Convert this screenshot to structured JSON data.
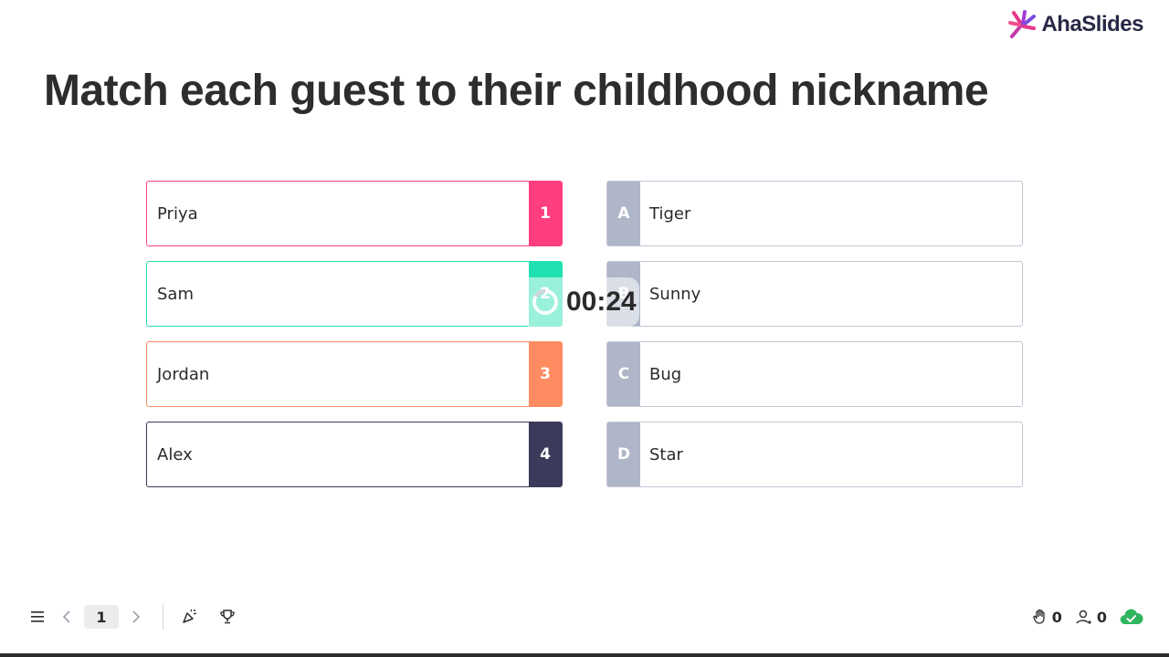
{
  "brand": {
    "name": "AhaSlides"
  },
  "slide": {
    "title": "Match each guest to their childhood nickname"
  },
  "left_items": [
    {
      "text": "Priya",
      "badge": "1",
      "color": "#ff3e80"
    },
    {
      "text": "Sam",
      "badge": "2",
      "color": "#1fe0b0"
    },
    {
      "text": "Jordan",
      "badge": "3",
      "color": "#ff8c60"
    },
    {
      "text": "Alex",
      "badge": "4",
      "color": "#3a3a5a"
    }
  ],
  "right_items": [
    {
      "text": "Tiger",
      "badge": "A"
    },
    {
      "text": "Sunny",
      "badge": "B"
    },
    {
      "text": "Bug",
      "badge": "C"
    },
    {
      "text": "Star",
      "badge": "D"
    }
  ],
  "timer": {
    "value": "00:24"
  },
  "controls": {
    "page": "1",
    "icons": [
      "menu-icon",
      "chevron-left-icon",
      "chevron-right-icon",
      "confetti-icon",
      "trophy-icon"
    ]
  },
  "stats": {
    "hands_raised": "0",
    "participants": "0",
    "status_color": "#2fb55d"
  },
  "colors": {
    "answer_badge": "#aeb6c8",
    "item_border": "#c4c6d6"
  }
}
